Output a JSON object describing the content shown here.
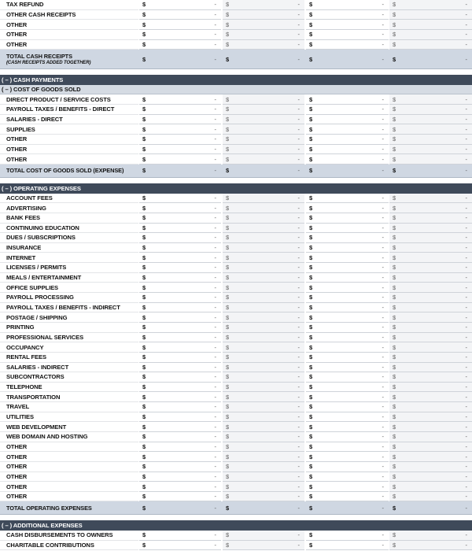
{
  "currency_symbol": "$",
  "empty_value": "-",
  "cash_receipts": {
    "items": [
      "TAX REFUND",
      "OTHER CASH RECEIPTS",
      "OTHER",
      "OTHER",
      "OTHER"
    ],
    "total_label": "TOTAL CASH RECEIPTS",
    "total_note": "(CASH RECEIPTS ADDED TOGETHER)"
  },
  "cash_payments": {
    "title": "( – )  CASH PAYMENTS"
  },
  "cost_of_goods_sold": {
    "title": "( – )  COST OF GOODS SOLD",
    "items": [
      "DIRECT PRODUCT / SERVICE COSTS",
      "PAYROLL TAXES / BENEFITS - DIRECT",
      "SALARIES - DIRECT",
      "SUPPLIES",
      "OTHER",
      "OTHER",
      "OTHER"
    ],
    "total_label": "TOTAL COST OF GOODS SOLD (EXPENSE)"
  },
  "operating_expenses": {
    "title": "( – )  OPERATING EXPENSES",
    "items": [
      "ACCOUNT FEES",
      "ADVERTISING",
      "BANK FEES",
      "CONTINUING EDUCATION",
      "DUES / SUBSCRIPTIONS",
      "INSURANCE",
      "INTERNET",
      "LICENSES / PERMITS",
      "MEALS / ENTERTAINMENT",
      "OFFICE SUPPLIES",
      "PAYROLL PROCESSING",
      "PAYROLL TAXES / BENEFITS - INDIRECT",
      "POSTAGE / SHIPPING",
      "PRINTING",
      "PROFESSIONAL SERVICES",
      "OCCUPANCY",
      "RENTAL FEES",
      "SALARIES - INDIRECT",
      "SUBCONTRACTORS",
      "TELEPHONE",
      "TRANSPORTATION",
      "TRAVEL",
      "UTILITIES",
      "WEB DEVELOPMENT",
      "WEB DOMAIN AND HOSTING",
      "OTHER",
      "OTHER",
      "OTHER",
      "OTHER",
      "OTHER",
      "OTHER"
    ],
    "total_label": "TOTAL OPERATING EXPENSES"
  },
  "additional_expenses": {
    "title": "( – )  ADDITIONAL EXPENSES",
    "items": [
      "CASH DISBURSEMENTS TO OWNERS",
      "CHARITABLE CONTRIBUTIONS"
    ]
  }
}
